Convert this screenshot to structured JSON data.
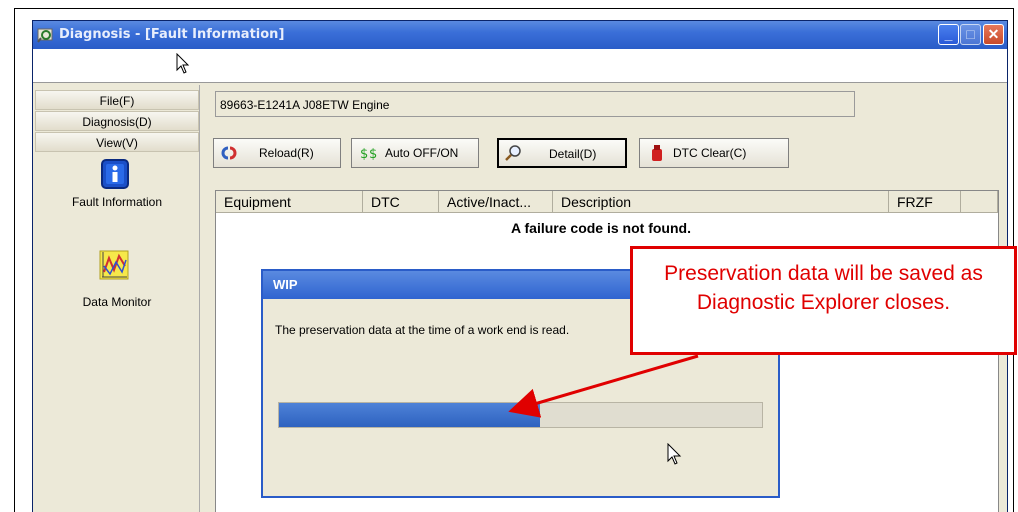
{
  "window": {
    "title": "Diagnosis - [Fault Information]"
  },
  "sidebar": {
    "menu": [
      {
        "label": "File(F)"
      },
      {
        "label": "Diagnosis(D)"
      },
      {
        "label": "View(V)"
      }
    ],
    "items": [
      {
        "label": "Fault Information",
        "icon": "info-icon"
      },
      {
        "label": "Data Monitor",
        "icon": "chart-icon"
      }
    ]
  },
  "main": {
    "ecu_label": "89663-E1241A J08ETW Engine",
    "toolbar": {
      "reload": "Reload(R)",
      "auto": "Auto OFF/ON",
      "detail": "Detail(D)",
      "dtc_clear": "DTC Clear(C)"
    },
    "table": {
      "columns": [
        "Equipment",
        "DTC",
        "Active/Inact...",
        "Description",
        "FRZF"
      ],
      "empty_message": "A failure code is not found."
    }
  },
  "dialog": {
    "title": "WIP",
    "message": "The preservation data at the time of a work end is read.",
    "progress": 0.54
  },
  "callout": {
    "text": "Preservation data will be saved as Diagnostic Explorer closes."
  },
  "colors": {
    "accent": "#e00000",
    "titlebar": "#2a5cc8",
    "progress": "#3a6fd0"
  }
}
